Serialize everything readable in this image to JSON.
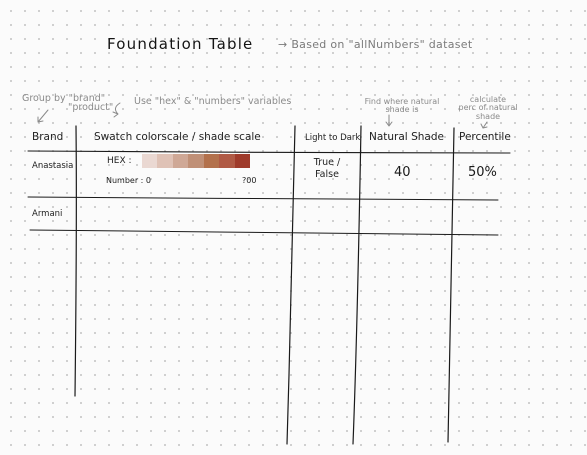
{
  "title": "Foundation Table",
  "subtitle": "→ Based on \"allNumbers\" dataset",
  "notes": {
    "group_by_line1": "Group by \"brand\"",
    "group_by_line2": "\"product\"",
    "use_vars": "Use \"hex\" & \"numbers\" variables",
    "find_line1": "Find where natural",
    "find_line2": "shade is",
    "calc_line1": "calculate",
    "calc_line2": "perc of natural",
    "calc_line3": "shade"
  },
  "columns": [
    "Brand",
    "Swatch colorscale / shade scale",
    "Light to Dark",
    "Natural Shade",
    "Percentile"
  ],
  "rows": [
    {
      "brand": "Anastasia",
      "hex_label": "HEX :",
      "number_label": "Number : 0",
      "number_max": "?00",
      "light_dark_line1": "True /",
      "light_dark_line2": "False",
      "natural_shade": "40",
      "percentile": "50%"
    },
    {
      "brand": "Armani"
    }
  ],
  "swatch_colors": [
    "#ead8d2",
    "#dfc2b6",
    "#cfa896",
    "#c09077",
    "#b3714c",
    "#b05a45",
    "#9f3b2b"
  ],
  "line_color": "#1a1a1a"
}
